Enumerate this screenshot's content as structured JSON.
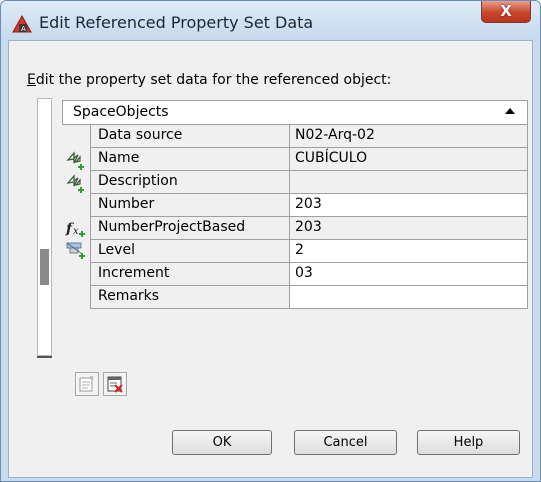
{
  "window": {
    "title": "Edit Referenced Property Set Data",
    "close_label": "X"
  },
  "prompt": {
    "accel": "E",
    "rest": "dit the property set data for the referenced object:"
  },
  "category": {
    "label": "SpaceObjects",
    "state": "expanded"
  },
  "properties": [
    {
      "name": "Data source",
      "value": "N02-Arq-02",
      "icon": "none",
      "editable": false
    },
    {
      "name": "Name",
      "value": "CUBÍCULO",
      "icon": "automatic-property-icon",
      "editable": false
    },
    {
      "name": "Description",
      "value": "",
      "icon": "automatic-property-icon",
      "editable": false
    },
    {
      "name": "Number",
      "value": "203",
      "icon": "none",
      "editable": true
    },
    {
      "name": "NumberProjectBased",
      "value": "203",
      "icon": "formula-property-icon",
      "editable": false
    },
    {
      "name": "Level",
      "value": "2",
      "icon": "classification-property-icon",
      "editable": true
    },
    {
      "name": "Increment",
      "value": "03",
      "icon": "none",
      "editable": true
    },
    {
      "name": "Remarks",
      "value": "",
      "icon": "none",
      "editable": true
    }
  ],
  "footer": {
    "ok_label": "OK",
    "cancel_label": "Cancel",
    "help_label": "Help"
  },
  "colors": {
    "titlebar": "#c5d9ee",
    "close": "#c9452c",
    "dialog_bg": "#f0f0f0",
    "icon_green": "#29a329"
  }
}
